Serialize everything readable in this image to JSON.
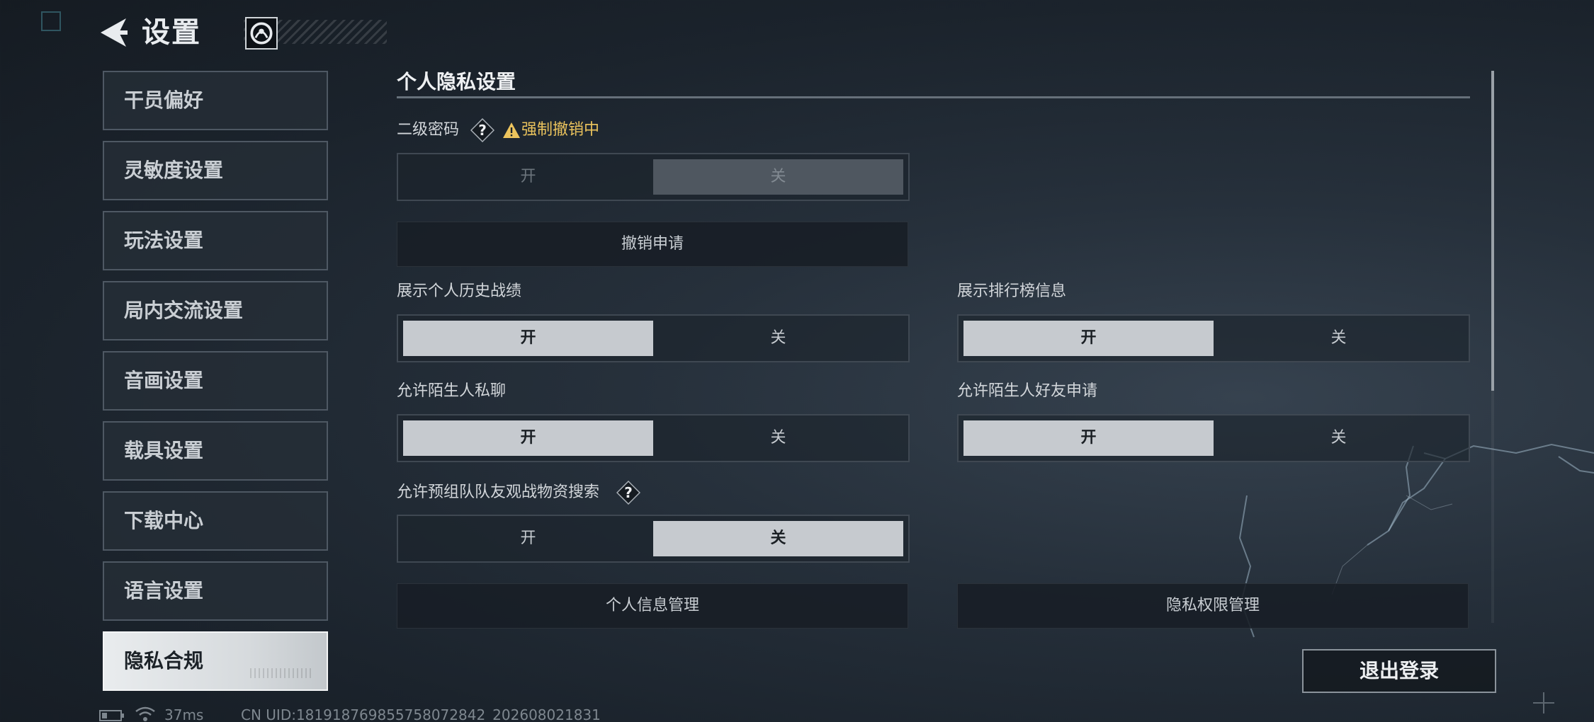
{
  "header": {
    "title": "设置",
    "back_icon": "back-arrow-icon",
    "avatar_icon": "profile-emblem-icon"
  },
  "sidebar": {
    "items": [
      {
        "label": "干员偏好",
        "active": false
      },
      {
        "label": "灵敏度设置",
        "active": false
      },
      {
        "label": "玩法设置",
        "active": false
      },
      {
        "label": "局内交流设置",
        "active": false
      },
      {
        "label": "音画设置",
        "active": false
      },
      {
        "label": "载具设置",
        "active": false
      },
      {
        "label": "下载中心",
        "active": false
      },
      {
        "label": "语言设置",
        "active": false
      },
      {
        "label": "隐私合规",
        "active": true
      }
    ]
  },
  "section": {
    "title": "个人隐私设置",
    "secondary_password": {
      "label": "二级密码",
      "help_icon": "question-mark-icon",
      "warning_icon": "warning-triangle-icon",
      "warning_text": "强制撤销中",
      "on_label": "开",
      "off_label": "关",
      "selected": "off",
      "disabled": true
    },
    "revoke_button": "撤销申请",
    "history_stats": {
      "label": "展示个人历史战绩",
      "on_label": "开",
      "off_label": "关",
      "selected": "on"
    },
    "leaderboard": {
      "label": "展示排行榜信息",
      "on_label": "开",
      "off_label": "关",
      "selected": "on"
    },
    "stranger_chat": {
      "label": "允许陌生人私聊",
      "on_label": "开",
      "off_label": "关",
      "selected": "on"
    },
    "stranger_friend": {
      "label": "允许陌生人好友申请",
      "on_label": "开",
      "off_label": "关",
      "selected": "on"
    },
    "team_spectate": {
      "label": "允许预组队队友观战物资搜索",
      "help_icon": "question-mark-icon",
      "on_label": "开",
      "off_label": "关",
      "selected": "off"
    },
    "personal_info_button": "个人信息管理",
    "privacy_permission_button": "隐私权限管理"
  },
  "logout_button": "退出登录",
  "status": {
    "battery_icon": "battery-icon",
    "wifi_icon": "wifi-icon",
    "ping": "37ms",
    "uid": "CN UID:181918769855758072842_202608021831"
  },
  "colors": {
    "background": "#1e2630",
    "selected_option": "#c6cacf",
    "warning": "#ecc45d",
    "active_tab": "#e4e7e9"
  }
}
